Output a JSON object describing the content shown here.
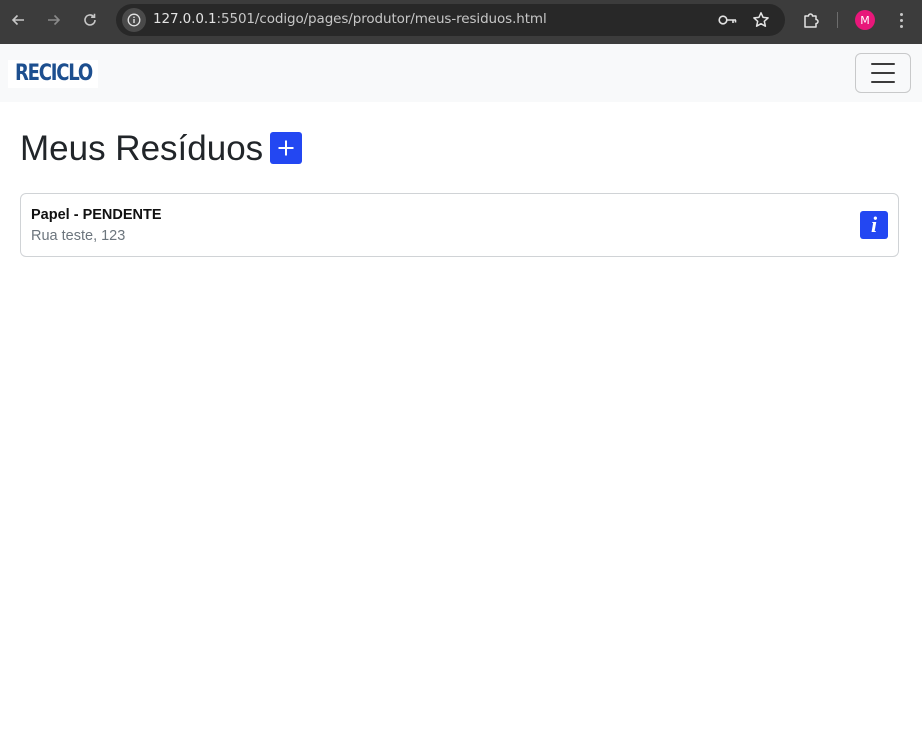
{
  "browser": {
    "url_main": "127.0.0.1",
    "url_rest": ":5501/codigo/pages/produtor/meus-residuos.html",
    "profile_initial": "M",
    "icons": {
      "back": "arrow-left-icon",
      "forward": "arrow-right-icon",
      "reload": "reload-icon",
      "site_info": "info-icon",
      "password": "key-icon",
      "bookmark": "star-icon",
      "extensions": "puzzle-icon",
      "menu": "more-vertical-icon"
    },
    "colors": {
      "frame": "#3c3c3c",
      "omnibox": "#282828",
      "avatar": "#e8177a"
    }
  },
  "navbar": {
    "logo_text": "RECICLO",
    "menu_toggle_icon": "hamburger-icon"
  },
  "main": {
    "title": "Meus Resíduos",
    "add_button_icon": "plus-icon",
    "residuos": [
      {
        "title": "Papel - PENDENTE",
        "address": "Rua teste, 123",
        "info_label": "i"
      }
    ]
  },
  "colors": {
    "primary": "#2347f2",
    "logo": "#1d4f8f",
    "navbar_bg": "#f8f9fa",
    "muted_text": "#6c757d"
  }
}
